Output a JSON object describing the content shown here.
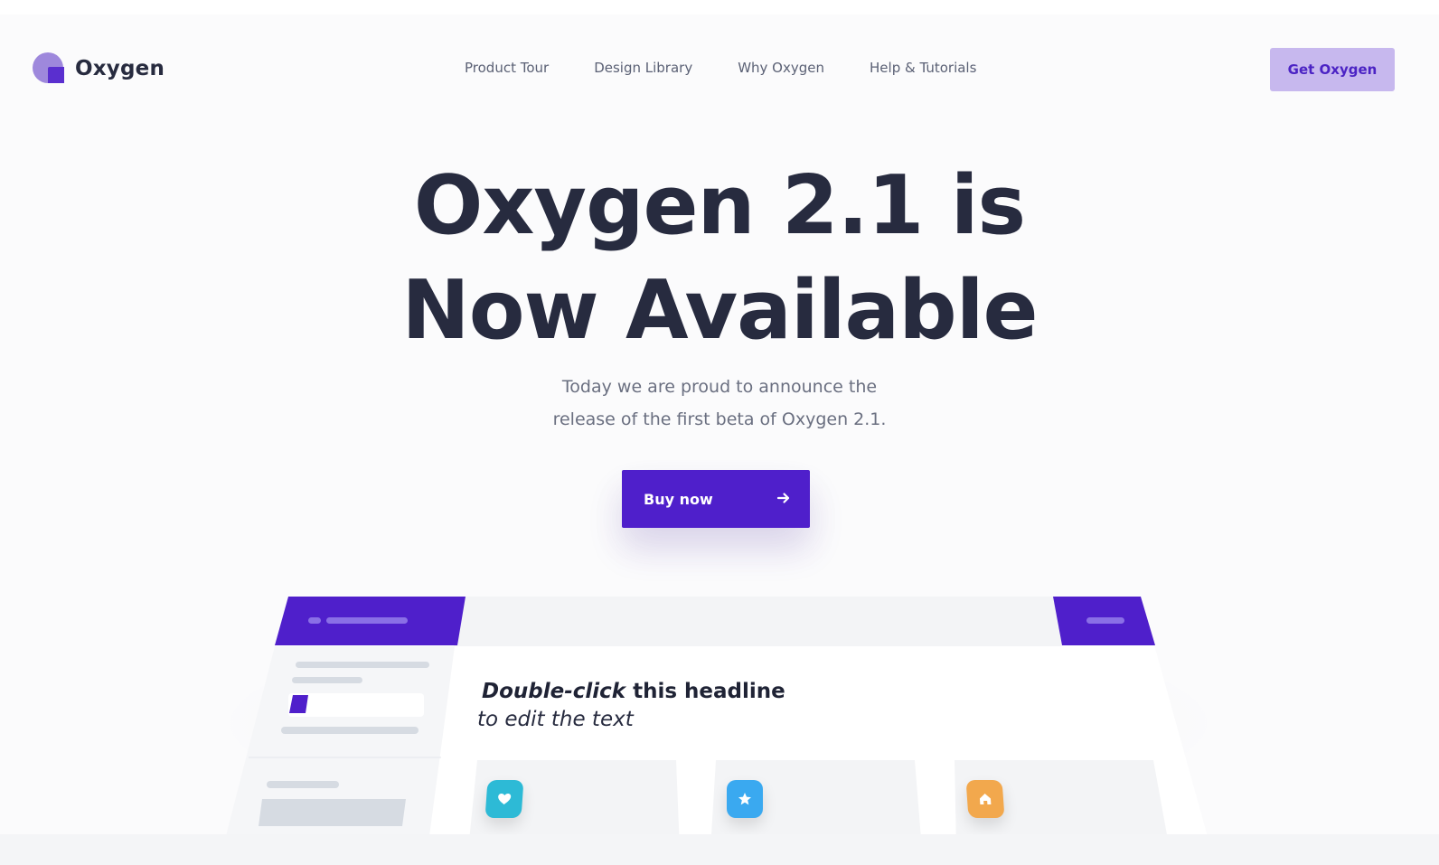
{
  "brand": {
    "name": "Oxygen"
  },
  "nav": {
    "items": [
      {
        "label": "Product Tour"
      },
      {
        "label": "Design Library"
      },
      {
        "label": "Why Oxygen"
      },
      {
        "label": "Help & Tutorials"
      }
    ]
  },
  "header": {
    "cta_label": "Get Oxygen"
  },
  "hero": {
    "title_line1": "Oxygen 2.1 is",
    "title_line2": "Now Available",
    "subtitle_line1": "Today we are proud to announce the",
    "subtitle_line2": "release of the first beta of Oxygen 2.1.",
    "button_label": "Buy now"
  },
  "mockup": {
    "headline_em": "Double-click",
    "headline_rest": " this headline",
    "subline": "to edit the text",
    "cards": [
      {
        "icon": "heart-icon",
        "color": "#2dbad6"
      },
      {
        "icon": "star-icon",
        "color": "#3aa9f0"
      },
      {
        "icon": "home-icon",
        "color": "#f2a84d"
      }
    ]
  },
  "colors": {
    "accent": "#4f1fcb",
    "accent_light": "#c7b8ee",
    "text_dark": "#272b3f",
    "text_muted": "#6a6f80"
  }
}
